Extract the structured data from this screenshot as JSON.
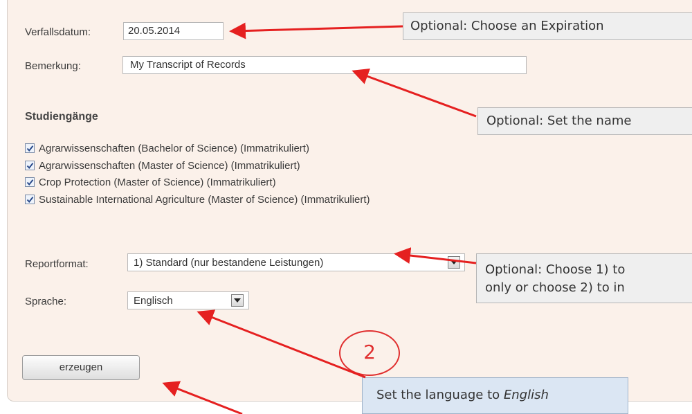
{
  "form": {
    "expiry_label": "Verfallsdatum:",
    "expiry_value": "20.05.2014",
    "remark_label": "Bemerkung:",
    "remark_value": "My Transcript of Records",
    "programs_heading": "Studiengänge",
    "programs": [
      {
        "label": "Agrarwissenschaften (Bachelor of Science) (Immatrikuliert)",
        "checked": true
      },
      {
        "label": "Agrarwissenschaften (Master of Science) (Immatrikuliert)",
        "checked": true
      },
      {
        "label": "Crop Protection (Master of Science) (Immatrikuliert)",
        "checked": true
      },
      {
        "label": "Sustainable International Agriculture (Master of Science) (Immatrikuliert)",
        "checked": true
      }
    ],
    "reportformat_label": "Reportformat:",
    "reportformat_value": "1) Standard (nur bestandene Leistungen)",
    "language_label": "Sprache:",
    "language_value": "Englisch",
    "generate_button": "erzeugen"
  },
  "annotations": {
    "expiry_note": "Optional: Choose an Expiration",
    "name_note": "Optional: Set the name",
    "format_note_line1": "Optional: Choose 1) to",
    "format_note_line2": "only or choose 2) to in",
    "language_note_prefix": "Set the language to ",
    "language_note_emph": "English",
    "step_number": "2"
  },
  "colors": {
    "panel_bg": "#fbf1ea",
    "arrow": "#e52020",
    "callout_grey": "#efefef",
    "callout_blue": "#dbe6f3"
  }
}
